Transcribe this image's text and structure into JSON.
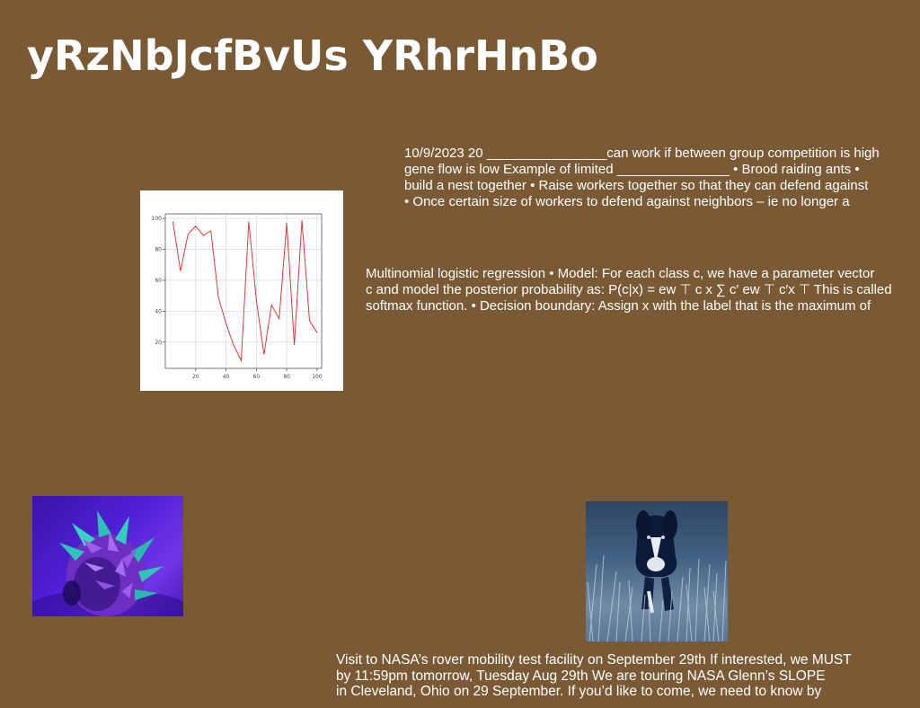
{
  "page": {
    "title": "yRzNbJcfBvUs YRhrHnBo"
  },
  "notes": {
    "biology": [
      "10/9/2023 20 ________________can work if between group competition is high",
      "gene flow is low Example of limited _______________ • Brood raiding ants •",
      "build a nest together • Raise workers together so that they can defend against",
      "• Once certain size of workers to defend against neighbors – ie no longer a"
    ],
    "regression": [
      "Multinomial logistic regression • Model: For each class c, we have a parameter vector",
      "c and model the posterior probability as: P(c|x) = ew ⊤ c x ∑ c′ ew ⊤ c′x ⊤ This is called",
      "softmax function. • Decision boundary: Assign x with the label that is the maximum of"
    ],
    "nasa": [
      "Visit to NASA’s rover mobility test facility on September 29th If interested, we MUST",
      "by 11:59pm tomorrow, Tuesday Aug 29th We are touring NASA Glenn’s SLOPE",
      "in Cleveland, Ohio on 29 September. If you’d like to come, we need to know by"
    ]
  },
  "images": {
    "fruit": "dragon-fruit-photo",
    "dog": "dog-in-tall-grass-photo"
  },
  "chart_data": {
    "type": "line",
    "title": "",
    "xlabel": "",
    "ylabel": "",
    "x": [
      5,
      10,
      15,
      20,
      25,
      30,
      35,
      40,
      45,
      50,
      55,
      60,
      65,
      70,
      75,
      80,
      85,
      90,
      95,
      100
    ],
    "series": [
      {
        "values": [
          98,
          66,
          90,
          95,
          89,
          92,
          49,
          32,
          18,
          8,
          98,
          47,
          12,
          44,
          35,
          97,
          18,
          99,
          34,
          26
        ],
        "color": "#e0393c"
      }
    ],
    "xticks": [
      20,
      40,
      60,
      80,
      100
    ],
    "yticks": [
      20,
      40,
      60,
      80,
      100
    ],
    "xlim": [
      0,
      103
    ],
    "ylim": [
      3,
      103
    ],
    "grid": true
  }
}
